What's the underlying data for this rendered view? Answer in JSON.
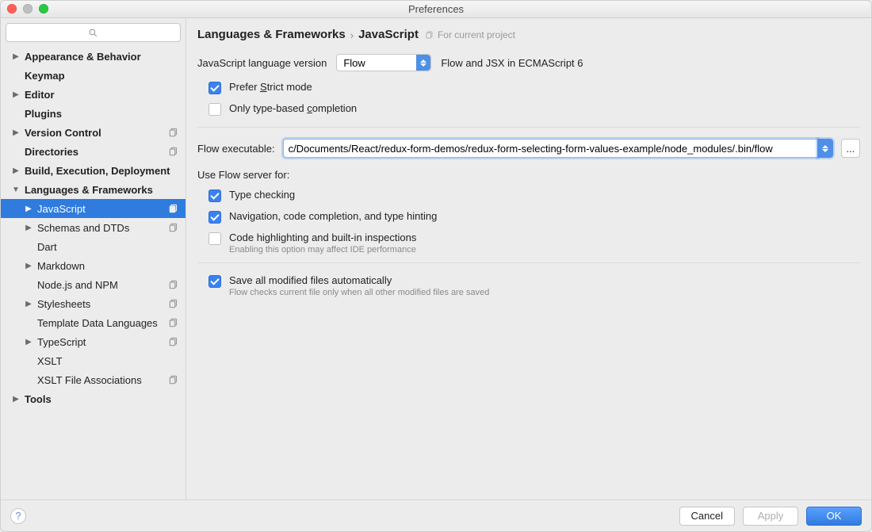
{
  "window": {
    "title": "Preferences"
  },
  "search": {
    "placeholder": ""
  },
  "tree": [
    {
      "label": "Appearance & Behavior",
      "indent": 0,
      "bold": true,
      "arrow": "right",
      "badge": false,
      "sel": false
    },
    {
      "label": "Keymap",
      "indent": 0,
      "bold": true,
      "arrow": "",
      "badge": false,
      "sel": false
    },
    {
      "label": "Editor",
      "indent": 0,
      "bold": true,
      "arrow": "right",
      "badge": false,
      "sel": false
    },
    {
      "label": "Plugins",
      "indent": 0,
      "bold": true,
      "arrow": "",
      "badge": false,
      "sel": false
    },
    {
      "label": "Version Control",
      "indent": 0,
      "bold": true,
      "arrow": "right",
      "badge": true,
      "sel": false
    },
    {
      "label": "Directories",
      "indent": 0,
      "bold": true,
      "arrow": "",
      "badge": true,
      "sel": false
    },
    {
      "label": "Build, Execution, Deployment",
      "indent": 0,
      "bold": true,
      "arrow": "right",
      "badge": false,
      "sel": false
    },
    {
      "label": "Languages & Frameworks",
      "indent": 0,
      "bold": true,
      "arrow": "down",
      "badge": false,
      "sel": false
    },
    {
      "label": "JavaScript",
      "indent": 1,
      "bold": false,
      "arrow": "right",
      "badge": true,
      "sel": true
    },
    {
      "label": "Schemas and DTDs",
      "indent": 1,
      "bold": false,
      "arrow": "right",
      "badge": true,
      "sel": false
    },
    {
      "label": "Dart",
      "indent": 1,
      "bold": false,
      "arrow": "",
      "badge": false,
      "sel": false
    },
    {
      "label": "Markdown",
      "indent": 1,
      "bold": false,
      "arrow": "right",
      "badge": false,
      "sel": false
    },
    {
      "label": "Node.js and NPM",
      "indent": 1,
      "bold": false,
      "arrow": "",
      "badge": true,
      "sel": false
    },
    {
      "label": "Stylesheets",
      "indent": 1,
      "bold": false,
      "arrow": "right",
      "badge": true,
      "sel": false
    },
    {
      "label": "Template Data Languages",
      "indent": 1,
      "bold": false,
      "arrow": "",
      "badge": true,
      "sel": false
    },
    {
      "label": "TypeScript",
      "indent": 1,
      "bold": false,
      "arrow": "right",
      "badge": true,
      "sel": false
    },
    {
      "label": "XSLT",
      "indent": 1,
      "bold": false,
      "arrow": "",
      "badge": false,
      "sel": false
    },
    {
      "label": "XSLT File Associations",
      "indent": 1,
      "bold": false,
      "arrow": "",
      "badge": true,
      "sel": false
    },
    {
      "label": "Tools",
      "indent": 0,
      "bold": true,
      "arrow": "right",
      "badge": false,
      "sel": false
    }
  ],
  "breadcrumb": {
    "a": "Languages & Frameworks",
    "b": "JavaScript",
    "hint": "For current project"
  },
  "langRow": {
    "label": "JavaScript language version",
    "value": "Flow",
    "note": "Flow and JSX in ECMAScript 6"
  },
  "strict": {
    "pre": "Prefer ",
    "u": "S",
    "post": "trict mode",
    "checked": true
  },
  "typeOnly": {
    "pre": "Only type-based ",
    "u": "c",
    "post": "ompletion",
    "checked": false
  },
  "exec": {
    "label": "Flow executable:",
    "value": "c/Documents/React/redux-form-demos/redux-form-selecting-form-values-example/node_modules/.bin/flow",
    "browse": "..."
  },
  "useFor": {
    "label": "Use Flow server for:",
    "items": [
      {
        "label": "Type checking",
        "checked": true,
        "sub": ""
      },
      {
        "label": "Navigation, code completion, and type hinting",
        "checked": true,
        "sub": ""
      },
      {
        "label": "Code highlighting and built-in inspections",
        "checked": false,
        "sub": "Enabling this option may affect IDE performance"
      }
    ]
  },
  "saveAll": {
    "label": "Save all modified files automatically",
    "sub": "Flow checks current file only when all other modified files are saved",
    "checked": true
  },
  "footer": {
    "cancel": "Cancel",
    "apply": "Apply",
    "ok": "OK"
  }
}
